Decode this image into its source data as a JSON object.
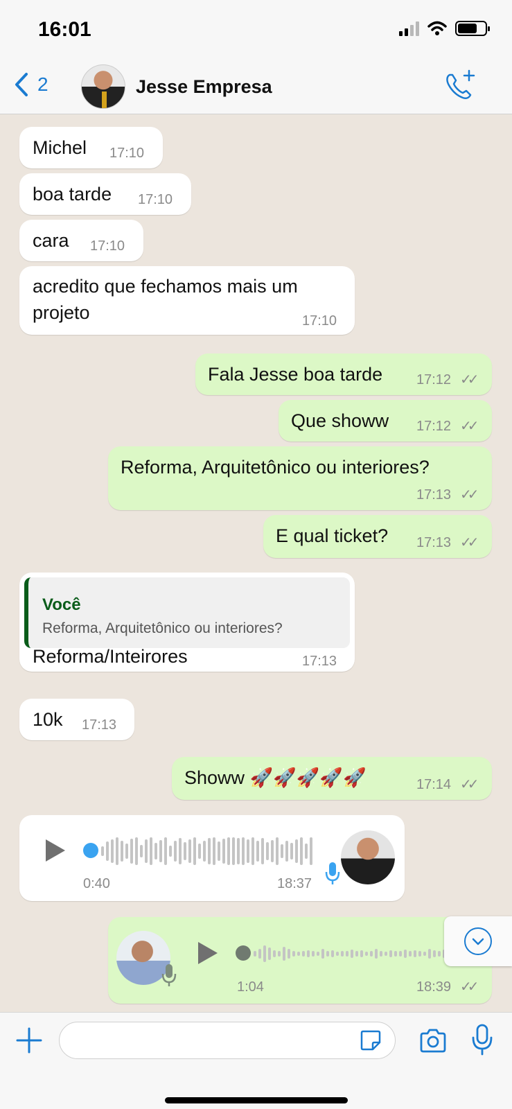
{
  "status_bar": {
    "time": "16:01"
  },
  "header": {
    "back_count": "2",
    "contact_name": "Jesse Empresa"
  },
  "messages": [
    {
      "text": "Michel",
      "time": "17:10"
    },
    {
      "text": "boa tarde",
      "time": "17:10"
    },
    {
      "text": "cara",
      "time": "17:10"
    },
    {
      "text_line1": "acredito que fechamos mais um",
      "text_line2": "projeto",
      "time": "17:10"
    },
    {
      "text": "Fala Jesse boa tarde",
      "time": "17:12"
    },
    {
      "text": "Que showw",
      "time": "17:12"
    },
    {
      "text": "Reforma, Arquitetônico ou interiores?",
      "time": "17:13"
    },
    {
      "text": "E qual ticket?",
      "time": "17:13"
    },
    {
      "quote_author": "Você",
      "quote_text": "Reforma, Arquitetônico ou interiores?",
      "text": "Reforma/Inteirores",
      "time": "17:13"
    },
    {
      "text": "10k",
      "time": "17:13"
    },
    {
      "text": "Showw 🚀🚀🚀🚀🚀",
      "time": "17:14"
    },
    {
      "duration": "0:40",
      "time": "18:37"
    },
    {
      "duration": "1:04",
      "time": "18:39"
    }
  ],
  "colors": {
    "incoming": "#ffffff",
    "outgoing": "#dcf8c6",
    "accent": "#1a7bd1",
    "chat_bg": "#ece5dd"
  },
  "icons": [
    "back-chevron-icon",
    "add-call-icon",
    "checkmarks-icon",
    "play-icon",
    "mic-icon",
    "chevron-down-icon",
    "plus-icon",
    "sticker-icon",
    "camera-icon"
  ]
}
